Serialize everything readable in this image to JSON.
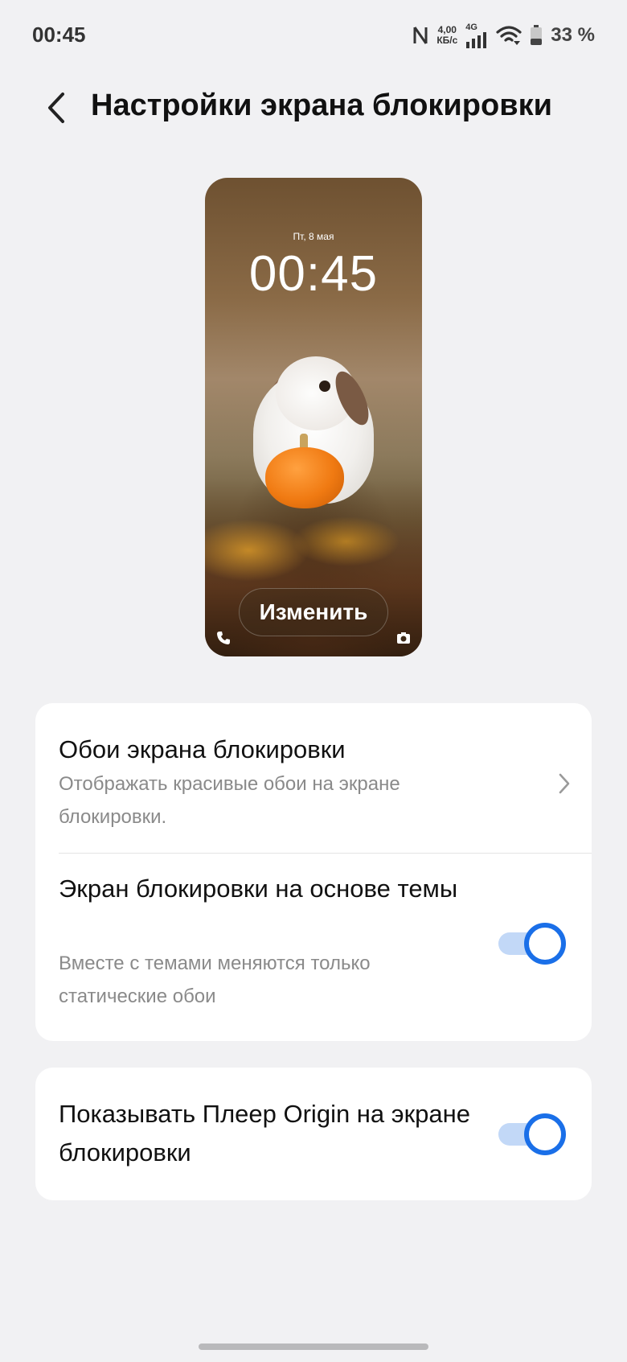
{
  "status_bar": {
    "time": "00:45",
    "net_speed_value": "4,00",
    "net_speed_unit": "КБ/с",
    "network_type": "4G",
    "battery_percent": "33 %"
  },
  "header": {
    "title": "Настройки экрана блокировки"
  },
  "preview": {
    "date": "Пт, 8 мая",
    "time": "00:45",
    "change_label": "Изменить"
  },
  "settings": {
    "wallpaper": {
      "title": "Обои экрана блокировки",
      "subtitle": "Отображать красивые обои на экране блокировки."
    },
    "theme_lockscreen": {
      "title": "Экран блокировки на основе темы",
      "subtitle": "Вместе с темами меняются только статические обои",
      "enabled": true
    },
    "origin_player": {
      "title": "Показывать Плеер Origin на экране блокировки",
      "enabled": true
    }
  },
  "colors": {
    "accent": "#1a6fe8",
    "toggle_track": "#c2d8f7",
    "background": "#f1f1f3"
  },
  "icons": [
    "nfc-icon",
    "signal-icon",
    "wifi-icon",
    "battery-icon",
    "back-arrow-icon",
    "chevron-right-icon",
    "phone-icon",
    "camera-icon"
  ]
}
